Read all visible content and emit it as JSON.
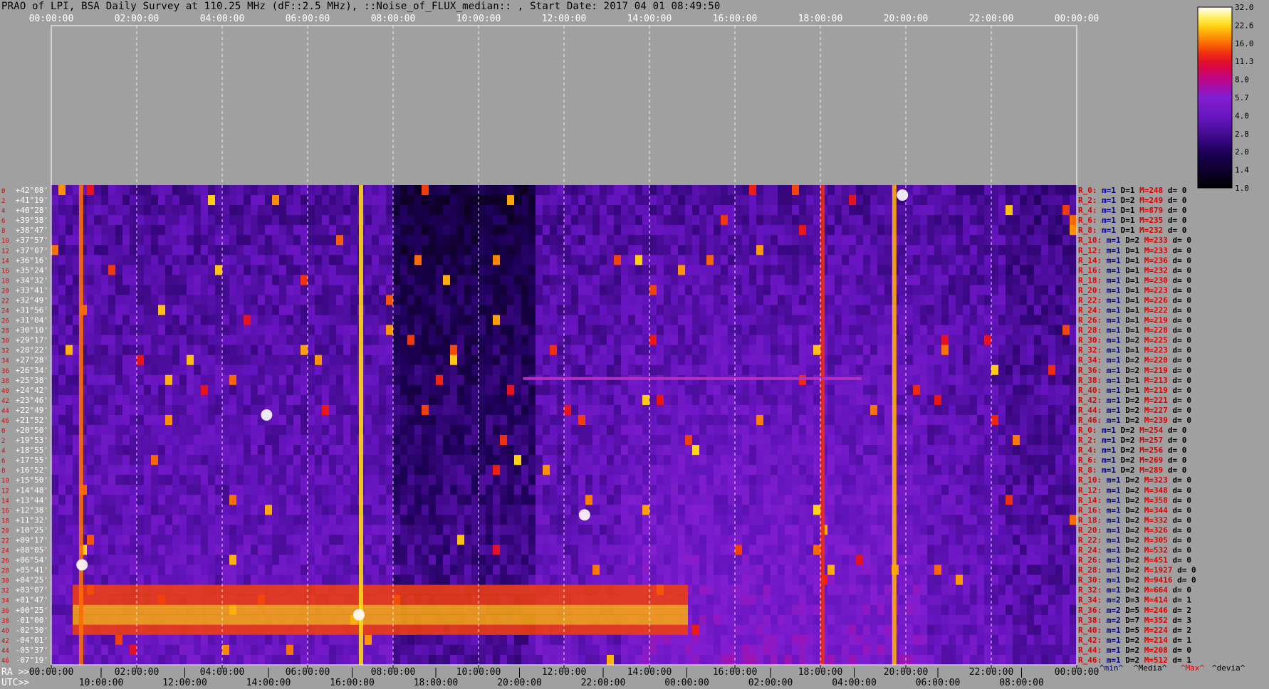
{
  "title": "PRAO of LPI, BSA Daily Survey at 110.25 MHz (dF::2.5 MHz), ::Noise_of_FLUX_median:: , Start Date: 2017 04 01 08:49:50",
  "colors": {
    "background": "#a0a0a0",
    "grid": "#ffffff",
    "label_red": "#e00000",
    "label_navy": "#000080"
  },
  "chart_data": {
    "type": "heatmap",
    "colormap": "black-purple-red-orange-yellow-white",
    "top_axis_ticks": [
      "00:00:00",
      "02:00:00",
      "04:00:00",
      "06:00:00",
      "08:00:00",
      "10:00:00",
      "12:00:00",
      "14:00:00",
      "16:00:00",
      "18:00:00",
      "20:00:00",
      "22:00:00",
      "00:00:00"
    ],
    "ra_prefix": "RA >>",
    "ra_ticks": [
      "00:00:00",
      "02:00:00",
      "04:00:00",
      "06:00:00",
      "08:00:00",
      "10:00:00",
      "12:00:00",
      "14:00:00",
      "16:00:00",
      "18:00:00",
      "20:00:00",
      "22:00:00",
      "00:00:00"
    ],
    "utc_prefix": "UTC>>",
    "utc_ticks": [
      "10:00:00",
      "12:00:00",
      "14:00:00",
      "16:00:00",
      "18:00:00",
      "20:00:00",
      "22:00:00",
      "00:00:00",
      "02:00:00",
      "04:00:00",
      "06:00:00",
      "08:00:00"
    ],
    "row_indices": [
      "0",
      "2",
      "4",
      "6",
      "8",
      "10",
      "12",
      "14",
      "16",
      "18",
      "20",
      "22",
      "24",
      "26",
      "28",
      "30",
      "32",
      "34",
      "36",
      "38",
      "40",
      "42",
      "44",
      "46",
      "0",
      "2",
      "4",
      "6",
      "8",
      "10",
      "12",
      "14",
      "16",
      "18",
      "20",
      "22",
      "24",
      "26",
      "28",
      "30",
      "32",
      "34",
      "36",
      "38",
      "40",
      "42",
      "44",
      "46"
    ],
    "declinations": [
      "+42°08'",
      "+41°19'",
      "+40°28'",
      "+39°38'",
      "+38°47'",
      "+37°57'",
      "+37°07'",
      "+36°16'",
      "+35°24'",
      "+34°32'",
      "+33°41'",
      "+32°49'",
      "+31°56'",
      "+31°04'",
      "+30°10'",
      "+29°17'",
      "+28°22'",
      "+27°28'",
      "+26°34'",
      "+25°38'",
      "+24°42'",
      "+23°46'",
      "+22°49'",
      "+21°52'",
      "+20°50'",
      "+19°53'",
      "+18°55'",
      "+17°55'",
      "+16°52'",
      "+15°50'",
      "+14°48'",
      "+13°44'",
      "+12°38'",
      "+11°32'",
      "+10°25'",
      "+09°17'",
      "+08°05'",
      "+06°54'",
      "+05°41'",
      "+04°25'",
      "+03°07'",
      "+01°47'",
      "+00°25'",
      "-01°00'",
      "-02°30'",
      "-04°01'",
      "-05°37'",
      "-07°19'"
    ],
    "beam_stats": [
      {
        "beam": "R_0:",
        "m": "m=1",
        "D": "D=1",
        "M": "M=248",
        "d": "d= 0"
      },
      {
        "beam": "R_2:",
        "m": "m=1",
        "D": "D=2",
        "M": "M=249",
        "d": "d= 0"
      },
      {
        "beam": "R_4:",
        "m": "m=1",
        "D": "D=1",
        "M": "M=879",
        "d": "d= 0"
      },
      {
        "beam": "R_6:",
        "m": "m=1",
        "D": "D=1",
        "M": "M=235",
        "d": "d= 0"
      },
      {
        "beam": "R_8:",
        "m": "m=1",
        "D": "D=1",
        "M": "M=232",
        "d": "d= 0"
      },
      {
        "beam": "R_10:",
        "m": "m=1",
        "D": "D=2",
        "M": "M=233",
        "d": "d= 0"
      },
      {
        "beam": "R_12:",
        "m": "m=1",
        "D": "D=1",
        "M": "M=233",
        "d": "d= 0"
      },
      {
        "beam": "R_14:",
        "m": "m=1",
        "D": "D=1",
        "M": "M=236",
        "d": "d= 0"
      },
      {
        "beam": "R_16:",
        "m": "m=1",
        "D": "D=1",
        "M": "M=232",
        "d": "d= 0"
      },
      {
        "beam": "R_18:",
        "m": "m=1",
        "D": "D=1",
        "M": "M=230",
        "d": "d= 0"
      },
      {
        "beam": "R_20:",
        "m": "m=1",
        "D": "D=1",
        "M": "M=223",
        "d": "d= 0"
      },
      {
        "beam": "R_22:",
        "m": "m=1",
        "D": "D=1",
        "M": "M=226",
        "d": "d= 0"
      },
      {
        "beam": "R_24:",
        "m": "m=1",
        "D": "D=1",
        "M": "M=222",
        "d": "d= 0"
      },
      {
        "beam": "R_26:",
        "m": "m=1",
        "D": "D=1",
        "M": "M=219",
        "d": "d= 0"
      },
      {
        "beam": "R_28:",
        "m": "m=1",
        "D": "D=1",
        "M": "M=228",
        "d": "d= 0"
      },
      {
        "beam": "R_30:",
        "m": "m=1",
        "D": "D=2",
        "M": "M=225",
        "d": "d= 0"
      },
      {
        "beam": "R_32:",
        "m": "m=1",
        "D": "D=1",
        "M": "M=223",
        "d": "d= 0"
      },
      {
        "beam": "R_34:",
        "m": "m=1",
        "D": "D=2",
        "M": "M=220",
        "d": "d= 0"
      },
      {
        "beam": "R_36:",
        "m": "m=1",
        "D": "D=2",
        "M": "M=219",
        "d": "d= 0"
      },
      {
        "beam": "R_38:",
        "m": "m=1",
        "D": "D=1",
        "M": "M=213",
        "d": "d= 0"
      },
      {
        "beam": "R_40:",
        "m": "m=1",
        "D": "D=1",
        "M": "M=219",
        "d": "d= 0"
      },
      {
        "beam": "R_42:",
        "m": "m=1",
        "D": "D=2",
        "M": "M=221",
        "d": "d= 0"
      },
      {
        "beam": "R_44:",
        "m": "m=1",
        "D": "D=2",
        "M": "M=227",
        "d": "d= 0"
      },
      {
        "beam": "R_46:",
        "m": "m=1",
        "D": "D=2",
        "M": "M=239",
        "d": "d= 0"
      },
      {
        "beam": "R_0:",
        "m": "m=1",
        "D": "D=2",
        "M": "M=254",
        "d": "d= 0"
      },
      {
        "beam": "R_2:",
        "m": "m=1",
        "D": "D=2",
        "M": "M=257",
        "d": "d= 0"
      },
      {
        "beam": "R_4:",
        "m": "m=1",
        "D": "D=2",
        "M": "M=256",
        "d": "d= 0"
      },
      {
        "beam": "R_6:",
        "m": "m=1",
        "D": "D=2",
        "M": "M=269",
        "d": "d= 0"
      },
      {
        "beam": "R_8:",
        "m": "m=1",
        "D": "D=2",
        "M": "M=289",
        "d": "d= 0"
      },
      {
        "beam": "R_10:",
        "m": "m=1",
        "D": "D=2",
        "M": "M=323",
        "d": "d= 0"
      },
      {
        "beam": "R_12:",
        "m": "m=1",
        "D": "D=2",
        "M": "M=348",
        "d": "d= 0"
      },
      {
        "beam": "R_14:",
        "m": "m=1",
        "D": "D=2",
        "M": "M=358",
        "d": "d= 0"
      },
      {
        "beam": "R_16:",
        "m": "m=1",
        "D": "D=2",
        "M": "M=344",
        "d": "d= 0"
      },
      {
        "beam": "R_18:",
        "m": "m=1",
        "D": "D=2",
        "M": "M=332",
        "d": "d= 0"
      },
      {
        "beam": "R_20:",
        "m": "m=1",
        "D": "D=2",
        "M": "M=326",
        "d": "d= 0"
      },
      {
        "beam": "R_22:",
        "m": "m=1",
        "D": "D=2",
        "M": "M=305",
        "d": "d= 0"
      },
      {
        "beam": "R_24:",
        "m": "m=1",
        "D": "D=2",
        "M": "M=532",
        "d": "d= 0"
      },
      {
        "beam": "R_26:",
        "m": "m=1",
        "D": "D=2",
        "M": "M=451",
        "d": "d= 0"
      },
      {
        "beam": "R_28:",
        "m": "m=1",
        "D": "D=2",
        "M": "M=1927",
        "d": "d= 0"
      },
      {
        "beam": "R_30:",
        "m": "m=1",
        "D": "D=2",
        "M": "M=9416",
        "d": "d= 0"
      },
      {
        "beam": "R_32:",
        "m": "m=1",
        "D": "D=2",
        "M": "M=664",
        "d": "d= 0"
      },
      {
        "beam": "R_34:",
        "m": "m=2",
        "D": "D=3",
        "M": "M=414",
        "d": "d= 1"
      },
      {
        "beam": "R_36:",
        "m": "m=2",
        "D": "D=5",
        "M": "M=246",
        "d": "d= 2"
      },
      {
        "beam": "R_38:",
        "m": "m=2",
        "D": "D=7",
        "M": "M=352",
        "d": "d= 3"
      },
      {
        "beam": "R_40:",
        "m": "m=1",
        "D": "D=5",
        "M": "M=224",
        "d": "d= 2"
      },
      {
        "beam": "R_42:",
        "m": "m=1",
        "D": "D=2",
        "M": "M=214",
        "d": "d= 1"
      },
      {
        "beam": "R_44:",
        "m": "m=1",
        "D": "D=2",
        "M": "M=208",
        "d": "d= 0"
      },
      {
        "beam": "R_46:",
        "m": "m=1",
        "D": "D=2",
        "M": "M=512",
        "d": "d= 1"
      }
    ],
    "stats_legend": {
      "min": "^min^",
      "median": "^Media^",
      "max": "^Max^",
      "dev": "^devia^"
    },
    "colorbar_ticks": [
      "32.0",
      "22.6",
      "16.0",
      "11.3",
      "8.0",
      "5.7",
      "4.0",
      "2.8",
      "2.0",
      "1.4",
      "1.0"
    ]
  }
}
